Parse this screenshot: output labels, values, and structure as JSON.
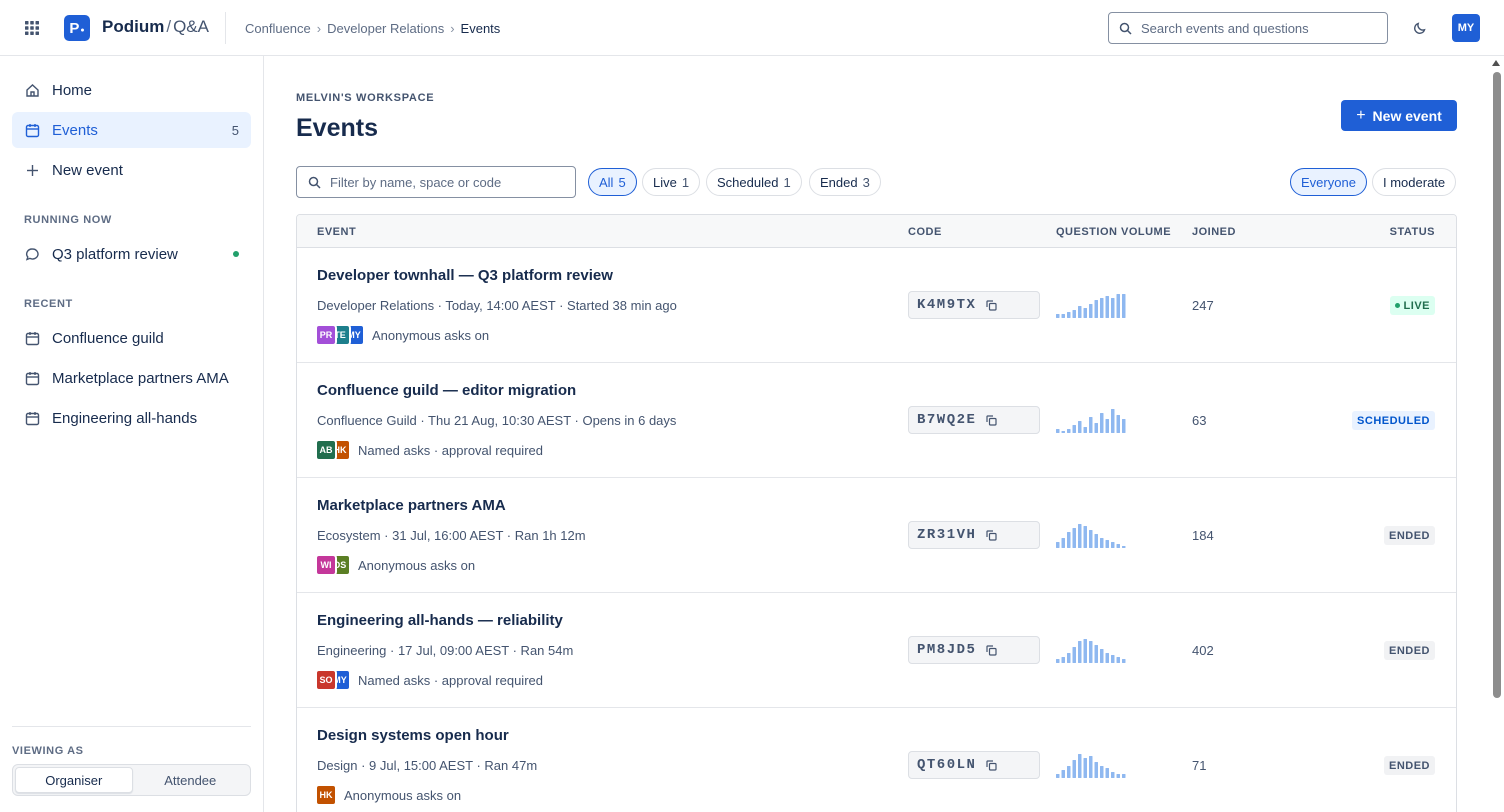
{
  "topbar": {
    "brand_name": "Podium",
    "brand_sep": "/",
    "brand_sub": "Q&A",
    "logo_letter": "P",
    "breadcrumbs": [
      "Confluence",
      "Developer Relations",
      "Events"
    ],
    "search_placeholder": "Search events and questions",
    "user_initials": "MY",
    "brand_color": "#1f5fd6"
  },
  "sidebar": {
    "nav": [
      {
        "label": "Home",
        "icon": "home-icon"
      },
      {
        "label": "Events",
        "icon": "calendar-icon",
        "count": "5",
        "active": true
      },
      {
        "label": "New event",
        "icon": "plus-icon"
      }
    ],
    "running_label": "RUNNING NOW",
    "running": [
      {
        "label": "Q3 platform review",
        "icon": "chat-bubble-icon",
        "live": true
      }
    ],
    "recent_label": "RECENT",
    "recent": [
      {
        "label": "Confluence guild"
      },
      {
        "label": "Marketplace partners AMA"
      },
      {
        "label": "Engineering all-hands"
      }
    ],
    "viewing_label": "VIEWING AS",
    "view_options": [
      "Organiser",
      "Attendee"
    ],
    "view_selected": "Organiser"
  },
  "main": {
    "workspace": "MELVIN'S WORKSPACE",
    "title": "Events",
    "new_event_label": "New event",
    "filter_placeholder": "Filter by name, space or code",
    "status_chips": [
      {
        "label": "All",
        "count": "5",
        "selected": true
      },
      {
        "label": "Live",
        "count": "1"
      },
      {
        "label": "Scheduled",
        "count": "1"
      },
      {
        "label": "Ended",
        "count": "3"
      }
    ],
    "scope_chips": [
      {
        "label": "Everyone",
        "selected": true
      },
      {
        "label": "I moderate"
      }
    ],
    "columns": [
      "EVENT",
      "CODE",
      "QUESTION VOLUME",
      "JOINED",
      "STATUS"
    ],
    "rows": [
      {
        "name": "Developer townhall — Q3 platform review",
        "meta": "Developer Relations · Today, 14:00 AEST · Started 38 min ago",
        "hosts": [
          {
            "initials": "PR",
            "color": "#a34fd8"
          },
          {
            "initials": "TE",
            "color": "#1d7f8c"
          },
          {
            "initials": "MY",
            "color": "#1f5fd6"
          }
        ],
        "asks": "Anonymous asks on",
        "code": "K4M9TX",
        "volume": [
          2,
          2,
          3,
          4,
          6,
          5,
          7,
          9,
          10,
          11,
          10,
          12,
          12
        ],
        "joined": "247",
        "status": "LIVE",
        "status_kind": "live"
      },
      {
        "name": "Confluence guild — editor migration",
        "meta": "Confluence Guild · Thu 21 Aug, 10:30 AEST · Opens in 6 days",
        "hosts": [
          {
            "initials": "AB",
            "color": "#216e4e"
          },
          {
            "initials": "HK",
            "color": "#c25100"
          }
        ],
        "asks": "Named asks · approval required",
        "code": "B7WQ2E",
        "volume": [
          2,
          1,
          2,
          4,
          6,
          3,
          8,
          5,
          10,
          7,
          12,
          9,
          7
        ],
        "joined": "63",
        "status": "SCHEDULED",
        "status_kind": "scheduled"
      },
      {
        "name": "Marketplace partners AMA",
        "meta": "Ecosystem · 31 Jul, 16:00 AEST · Ran 1h 12m",
        "hosts": [
          {
            "initials": "WI",
            "color": "#c4379a"
          },
          {
            "initials": "DS",
            "color": "#5b7f24"
          }
        ],
        "asks": "Anonymous asks on",
        "code": "ZR31VH",
        "volume": [
          3,
          5,
          8,
          10,
          12,
          11,
          9,
          7,
          5,
          4,
          3,
          2,
          1
        ],
        "joined": "184",
        "status": "ENDED",
        "status_kind": "ended"
      },
      {
        "name": "Engineering all-hands — reliability",
        "meta": "Engineering · 17 Jul, 09:00 AEST · Ran 54m",
        "hosts": [
          {
            "initials": "SO",
            "color": "#c9372c"
          },
          {
            "initials": "MY",
            "color": "#1f5fd6"
          }
        ],
        "asks": "Named asks · approval required",
        "code": "PM8JD5",
        "volume": [
          2,
          3,
          5,
          8,
          11,
          12,
          11,
          9,
          7,
          5,
          4,
          3,
          2
        ],
        "joined": "402",
        "status": "ENDED",
        "status_kind": "ended"
      },
      {
        "name": "Design systems open hour",
        "meta": "Design · 9 Jul, 15:00 AEST · Ran 47m",
        "hosts": [
          {
            "initials": "HK",
            "color": "#c25100"
          }
        ],
        "asks": "Anonymous asks on",
        "code": "QT60LN",
        "volume": [
          2,
          4,
          6,
          9,
          12,
          10,
          11,
          8,
          6,
          5,
          3,
          2,
          2
        ],
        "joined": "71",
        "status": "ENDED",
        "status_kind": "ended"
      }
    ]
  }
}
